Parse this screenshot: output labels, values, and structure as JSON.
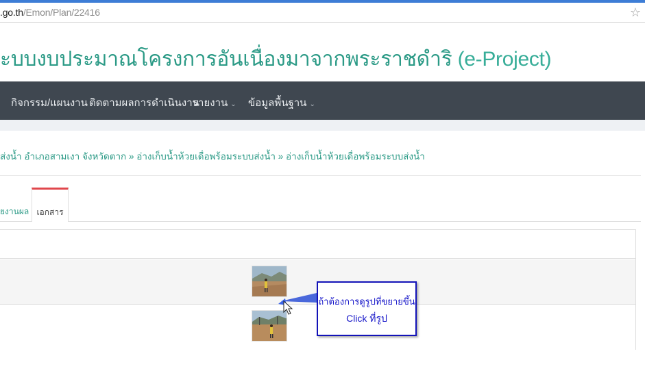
{
  "browser": {
    "url_domain": ".go.th",
    "url_path": "/Emon/Plan/22416",
    "bookmark_icon": "star-icon"
  },
  "header": {
    "title_thai": "ะบบงบประมาณโครงการอันเนื่องมาจากพระราชดำริ",
    "title_suffix": "(e-Project)"
  },
  "nav": {
    "items": [
      {
        "label": "กิจกรรม/แผนงาน",
        "has_caret": false
      },
      {
        "label": "ติดตามผลการดำเนินงาน",
        "has_caret": false
      },
      {
        "label": "รายงาน",
        "has_caret": true
      },
      {
        "label": "ข้อมูลพื้นฐาน",
        "has_caret": true
      }
    ]
  },
  "breadcrumb": {
    "text": "ส่งน้ำ อำเภอสามเงา จังหวัดตาก » อ่างเก็บน้ำห้วยเดื่อพร้อมระบบส่งน้ำ » อ่างเก็บน้ำห้วยเดื่อพร้อมระบบส่งน้ำ"
  },
  "tabs": {
    "report_label": "ยงานผล",
    "documents_label": "เอกสาร",
    "active": "documents"
  },
  "callout": {
    "line1": "ถ้าต้องการดูรูปที่ขยายขึ้น",
    "line2": "Click ที่รูป",
    "border_color": "#1212b8",
    "text_color": "#1414c8"
  },
  "colors": {
    "accent": "#2b9a86",
    "navbar": "#3f4750",
    "active_tab": "#e0474c",
    "browser_top": "#3d7dd6"
  }
}
